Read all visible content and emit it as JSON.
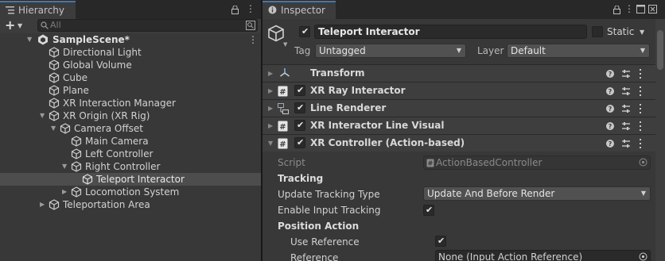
{
  "hierarchy": {
    "tab_label": "Hierarchy",
    "add_label": "+",
    "search_placeholder": "All",
    "items": [
      {
        "label": "SampleScene*",
        "bold": true,
        "icon": "unity-scene-icon",
        "arrow": "down",
        "menu": true
      },
      {
        "label": "Directional Light",
        "icon": "gameobject-icon"
      },
      {
        "label": "Global Volume",
        "icon": "gameobject-icon"
      },
      {
        "label": "Cube",
        "icon": "gameobject-icon"
      },
      {
        "label": "Plane",
        "icon": "gameobject-icon"
      },
      {
        "label": "XR Interaction Manager",
        "icon": "gameobject-icon"
      },
      {
        "label": "XR Origin (XR Rig)",
        "icon": "gameobject-icon",
        "arrow": "down"
      },
      {
        "label": "Camera Offset",
        "icon": "gameobject-icon",
        "arrow": "down"
      },
      {
        "label": "Main Camera",
        "icon": "gameobject-icon"
      },
      {
        "label": "Left Controller",
        "icon": "gameobject-icon"
      },
      {
        "label": "Right Controller",
        "icon": "gameobject-icon",
        "arrow": "down"
      },
      {
        "label": "Teleport Interactor",
        "icon": "gameobject-icon",
        "selected": true
      },
      {
        "label": "Locomotion System",
        "icon": "gameobject-icon",
        "arrow": "right"
      },
      {
        "label": "Teleportation Area",
        "icon": "gameobject-icon",
        "arrow": "right"
      }
    ]
  },
  "inspector": {
    "tab_label": "Inspector",
    "object_name": "Teleport Interactor",
    "static_label": "Static",
    "tag_label": "Tag",
    "tag_value": "Untagged",
    "layer_label": "Layer",
    "layer_value": "Default",
    "components": [
      {
        "name": "Transform",
        "icon": "transform-icon",
        "checkbox": false
      },
      {
        "name": "XR Ray Interactor",
        "icon": "script-icon",
        "checkbox": true
      },
      {
        "name": "Line Renderer",
        "icon": "line-renderer-icon",
        "checkbox": true
      },
      {
        "name": "XR Interactor Line Visual",
        "icon": "script-icon",
        "checkbox": true
      },
      {
        "name": "XR Controller (Action-based)",
        "icon": "script-icon",
        "checkbox": true,
        "expanded": true
      }
    ],
    "props": {
      "script_label": "Script",
      "script_value": "ActionBasedController",
      "tracking_header": "Tracking",
      "update_tracking_label": "Update Tracking Type",
      "update_tracking_value": "Update And Before Render",
      "enable_input_label": "Enable Input Tracking",
      "position_header": "Position Action",
      "use_reference_label": "Use Reference",
      "reference_label": "Reference",
      "reference_value": "None (Input Action Reference)"
    }
  },
  "colors": {
    "panel_bg": "#383838",
    "tab_accent": "#3a79bb",
    "selection": "#4d4d4d"
  }
}
